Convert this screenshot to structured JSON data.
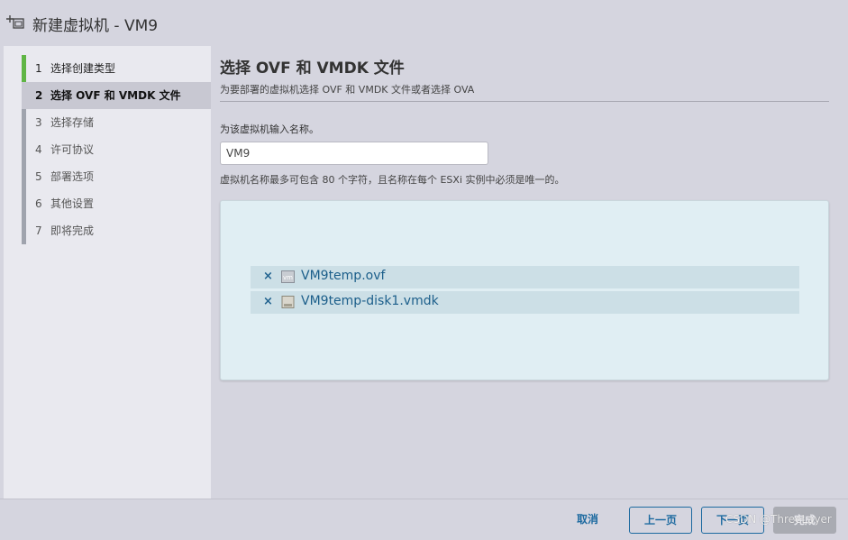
{
  "window": {
    "title": "新建虚拟机 - VM9"
  },
  "steps": [
    {
      "num": "1",
      "label": "选择创建类型",
      "state": "done"
    },
    {
      "num": "2",
      "label": "选择 OVF 和 VMDK 文件",
      "state": "active"
    },
    {
      "num": "3",
      "label": "选择存储",
      "state": "pending"
    },
    {
      "num": "4",
      "label": "许可协议",
      "state": "pending"
    },
    {
      "num": "5",
      "label": "部署选项",
      "state": "pending"
    },
    {
      "num": "6",
      "label": "其他设置",
      "state": "pending"
    },
    {
      "num": "7",
      "label": "即将完成",
      "state": "pending"
    }
  ],
  "main": {
    "title": "选择 OVF 和 VMDK 文件",
    "subtitle": "为要部署的虚拟机选择 OVF 和 VMDK 文件或者选择 OVA",
    "name_label": "为该虚拟机输入名称。",
    "name_value": "VM9",
    "name_hint": "虚拟机名称最多可包含 80 个字符，且名称在每个 ESXi 实例中必须是唯一的。",
    "files": [
      {
        "name": "VM9temp.ovf",
        "icon": "vm-template-icon",
        "remove": "×"
      },
      {
        "name": "VM9temp-disk1.vmdk",
        "icon": "disk-icon",
        "remove": "×"
      }
    ]
  },
  "footer": {
    "cancel": "取消",
    "back": "上一页",
    "next": "下一页",
    "finish": "完成"
  },
  "watermark": "CSDN @ThreeLayer",
  "colors": {
    "accent": "#1d6aa0",
    "done_step": "#5fb544",
    "drop_area": "#e0eef3",
    "file_row": "#ccdfe6"
  }
}
